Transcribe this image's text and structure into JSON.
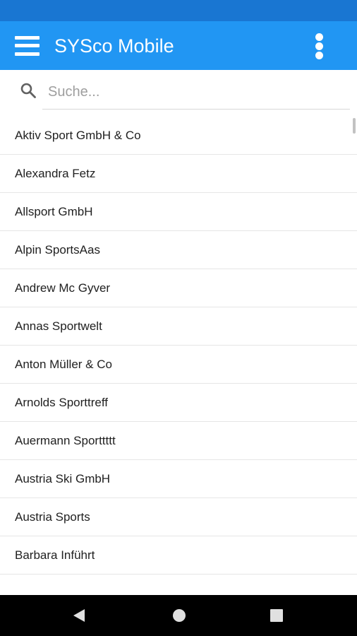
{
  "app": {
    "title": "SYSco Mobile",
    "accent_color": "#2196f3",
    "status_bar_color": "#1976d2"
  },
  "toolbar": {
    "menu_icon": "hamburger-menu-icon",
    "overflow_icon": "more-vert-icon"
  },
  "search": {
    "placeholder": "Suche...",
    "value": "",
    "icon": "search-icon"
  },
  "customers": [
    "Aktiv Sport GmbH & Co",
    "Alexandra Fetz",
    "Allsport GmbH",
    "Alpin SportsAas",
    "Andrew Mc Gyver",
    "Annas Sportwelt",
    "Anton Müller & Co",
    "Arnolds Sporttreff",
    "Auermann Sporttttt",
    "Austria Ski GmbH",
    "Austria Sports",
    "Barbara Inführt"
  ],
  "navigation": {
    "back_icon": "back-triangle-icon",
    "home_icon": "home-circle-icon",
    "recents_icon": "recents-square-icon"
  }
}
